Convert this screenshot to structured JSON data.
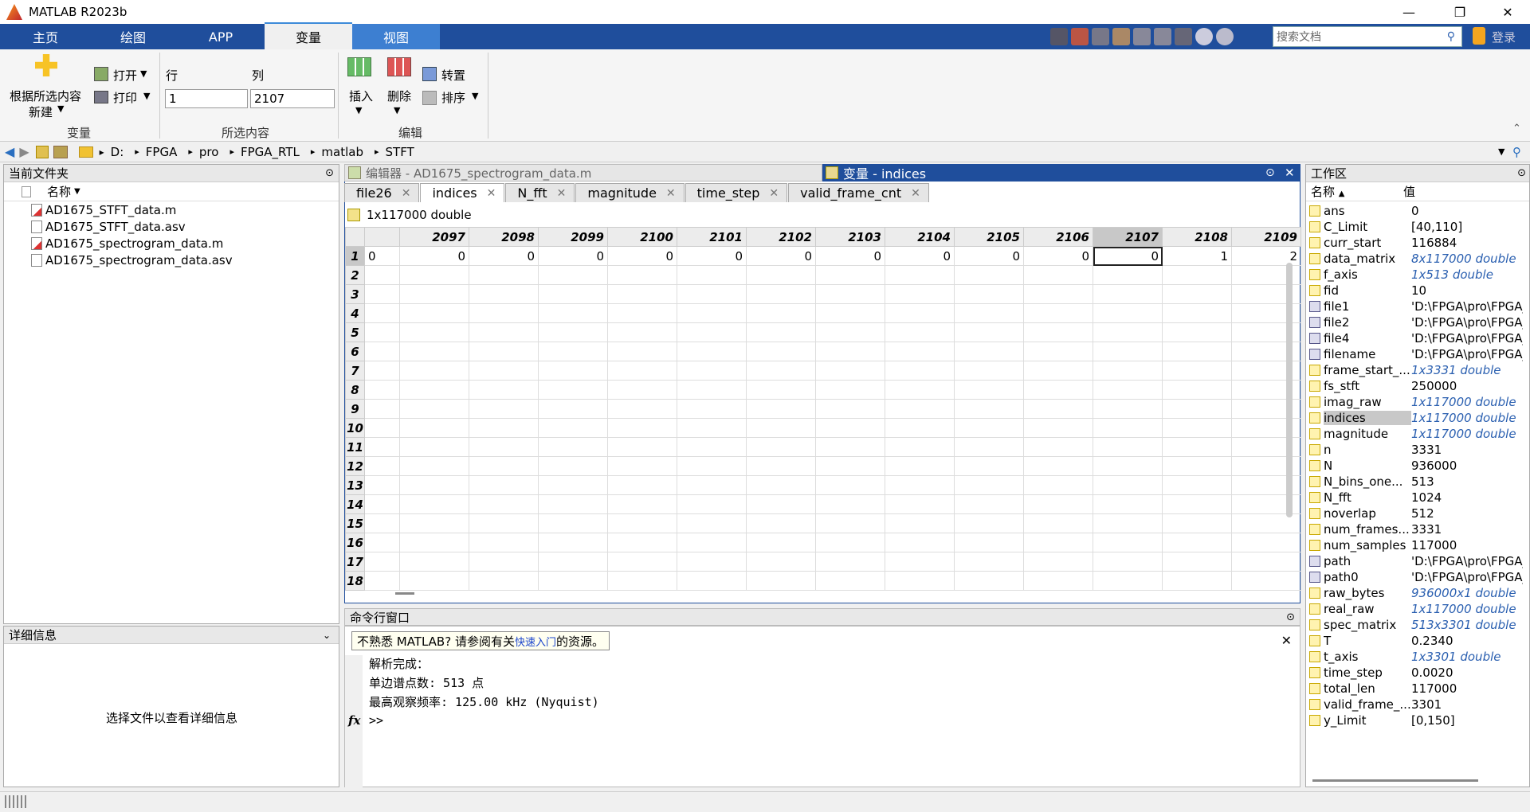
{
  "window": {
    "title": "MATLAB R2023b",
    "minimize": "—",
    "restore": "❐",
    "close": "✕"
  },
  "ribbon_tabs": [
    "主页",
    "绘图",
    "APP",
    "变量",
    "视图"
  ],
  "search": {
    "placeholder": "搜索文档"
  },
  "user_label": "登录",
  "ribbon": {
    "new_from_selection": "根据所选内容",
    "new_label": "新建",
    "open_label": "打开",
    "print_label": "打印",
    "row_label": "行",
    "col_label": "列",
    "row_value": "1",
    "col_value": "2107",
    "insert_label": "插入",
    "delete_label": "删除",
    "transpose_label": "转置",
    "sort_label": "排序",
    "group_variable": "变量",
    "group_selection": "所选内容",
    "group_edit": "编辑"
  },
  "address": {
    "crumbs": [
      "D:",
      "FPGA",
      "pro",
      "FPGA_RTL",
      "matlab",
      "STFT"
    ]
  },
  "current_folder": {
    "title": "当前文件夹",
    "col_name": "名称",
    "files": [
      {
        "name": "AD1675_STFT_data.m",
        "type": "m"
      },
      {
        "name": "AD1675_STFT_data.asv",
        "type": "asv"
      },
      {
        "name": "AD1675_spectrogram_data.m",
        "type": "m"
      },
      {
        "name": "AD1675_spectrogram_data.asv",
        "type": "asv"
      }
    ]
  },
  "details": {
    "title": "详细信息",
    "message": "选择文件以查看详细信息"
  },
  "editor": {
    "title": "编辑器 - AD1675_spectrogram_data.m"
  },
  "variables": {
    "title": "变量 - indices",
    "tabs": [
      "file26",
      "indices",
      "N_fft",
      "magnitude",
      "time_step",
      "valid_frame_cnt"
    ],
    "active_tab": "indices",
    "dims": "1x117000 double",
    "columns": [
      "2097",
      "2098",
      "2099",
      "2100",
      "2101",
      "2102",
      "2103",
      "2104",
      "2105",
      "2106",
      "2107",
      "2108",
      "2109"
    ],
    "rows": [
      "1",
      "2",
      "3",
      "4",
      "5",
      "6",
      "7",
      "8",
      "9",
      "10",
      "11",
      "12",
      "13",
      "14",
      "15",
      "16",
      "17",
      "18"
    ],
    "row1_first": "0",
    "row1": [
      "0",
      "0",
      "0",
      "0",
      "0",
      "0",
      "0",
      "0",
      "0",
      "0",
      "0",
      "1",
      "2"
    ]
  },
  "command_window": {
    "title": "命令行窗口",
    "banner_prefix": "不熟悉 MATLAB? 请参阅有关",
    "banner_link": "快速入门",
    "banner_suffix": "的资源。",
    "lines": [
      "解析完成：",
      "单边谱点数: 513 点",
      "最高观察频率: 125.00 kHz (Nyquist)"
    ],
    "prompt": ">>",
    "fx": "fx"
  },
  "workspace": {
    "title": "工作区",
    "col_name": "名称",
    "col_value": "值",
    "vars": [
      {
        "name": "ans",
        "value": "0",
        "italic": false
      },
      {
        "name": "C_Limit",
        "value": "[40,110]",
        "italic": false
      },
      {
        "name": "curr_start",
        "value": "116884",
        "italic": false
      },
      {
        "name": "data_matrix",
        "value": "8x117000 double",
        "italic": true
      },
      {
        "name": "f_axis",
        "value": "1x513 double",
        "italic": true
      },
      {
        "name": "fid",
        "value": "10",
        "italic": false
      },
      {
        "name": "file1",
        "value": "'D:\\FPGA\\pro\\FPGA_",
        "italic": false,
        "char": true
      },
      {
        "name": "file2",
        "value": "'D:\\FPGA\\pro\\FPGA_",
        "italic": false,
        "char": true
      },
      {
        "name": "file4",
        "value": "'D:\\FPGA\\pro\\FPGA_",
        "italic": false,
        "char": true
      },
      {
        "name": "filename",
        "value": "'D:\\FPGA\\pro\\FPGA_",
        "italic": false,
        "char": true
      },
      {
        "name": "frame_start_...",
        "value": "1x3331 double",
        "italic": true
      },
      {
        "name": "fs_stft",
        "value": "250000",
        "italic": false
      },
      {
        "name": "imag_raw",
        "value": "1x117000 double",
        "italic": true
      },
      {
        "name": "indices",
        "value": "1x117000 double",
        "italic": true,
        "selected": true
      },
      {
        "name": "magnitude",
        "value": "1x117000 double",
        "italic": true
      },
      {
        "name": "n",
        "value": "3331",
        "italic": false
      },
      {
        "name": "N",
        "value": "936000",
        "italic": false
      },
      {
        "name": "N_bins_one...",
        "value": "513",
        "italic": false
      },
      {
        "name": "N_fft",
        "value": "1024",
        "italic": false
      },
      {
        "name": "noverlap",
        "value": "512",
        "italic": false
      },
      {
        "name": "num_frames...",
        "value": "3331",
        "italic": false
      },
      {
        "name": "num_samples",
        "value": "117000",
        "italic": false
      },
      {
        "name": "path",
        "value": "'D:\\FPGA\\pro\\FPGA_",
        "italic": false,
        "char": true
      },
      {
        "name": "path0",
        "value": "'D:\\FPGA\\pro\\FPGA_",
        "italic": false,
        "char": true
      },
      {
        "name": "raw_bytes",
        "value": "936000x1 double",
        "italic": true
      },
      {
        "name": "real_raw",
        "value": "1x117000 double",
        "italic": true
      },
      {
        "name": "spec_matrix",
        "value": "513x3301 double",
        "italic": true
      },
      {
        "name": "T",
        "value": "0.2340",
        "italic": false
      },
      {
        "name": "t_axis",
        "value": "1x3301 double",
        "italic": true
      },
      {
        "name": "time_step",
        "value": "0.0020",
        "italic": false
      },
      {
        "name": "total_len",
        "value": "117000",
        "italic": false
      },
      {
        "name": "valid_frame_...",
        "value": "3301",
        "italic": false
      },
      {
        "name": "y_Limit",
        "value": "[0,150]",
        "italic": false
      }
    ]
  },
  "colors": {
    "ribbon_tab_bg": "#1f4e9c",
    "view_tab_bg": "#3d7fd1",
    "link": "#2a5fb0"
  }
}
